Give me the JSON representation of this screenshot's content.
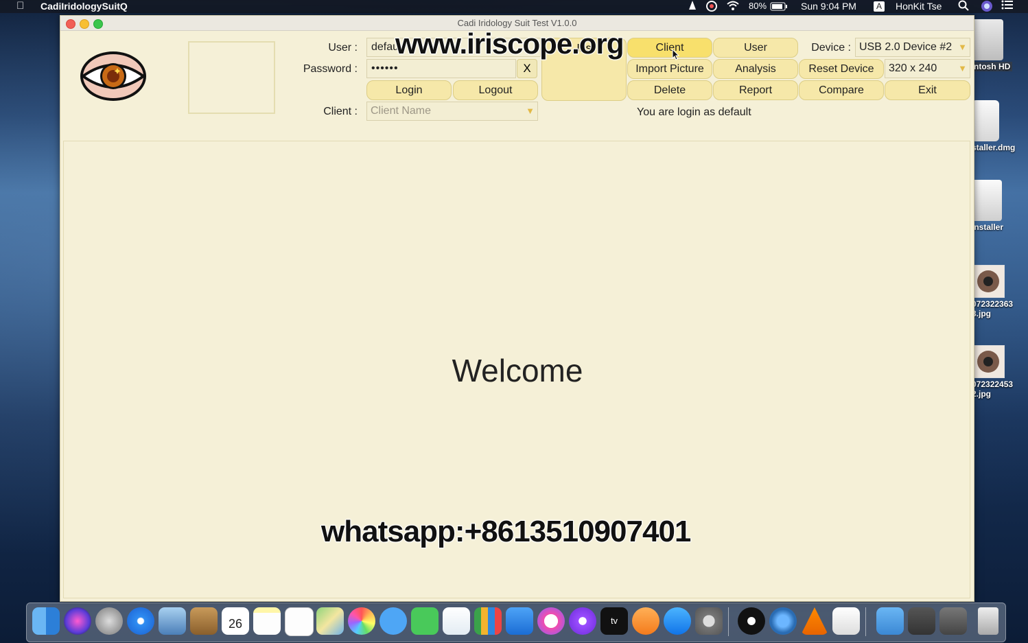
{
  "menubar": {
    "app_name": "CadiIridologySuitQ",
    "battery": "80%",
    "clock": "Sun 9:04 PM",
    "input_source": "A",
    "user": "HonKit Tse"
  },
  "window": {
    "title": "Cadi Iridology Suit Test V1.0.0"
  },
  "login": {
    "user_label": "User :",
    "user_value": "defau",
    "password_label": "Password :",
    "password_value": "••••••",
    "clear_label": "X",
    "login_label": "Login",
    "logout_label": "Logout",
    "client_label": "Client :",
    "client_placeholder": "Client Name"
  },
  "toolbar": {
    "iris": "Iris",
    "client": "Client",
    "user": "User",
    "import_picture": "Import Picture",
    "analysis": "Analysis",
    "delete": "Delete",
    "report": "Report",
    "reset_device": "Reset Device",
    "compare": "Compare",
    "exit": "Exit",
    "device_label": "Device :",
    "device_value": "USB 2.0 Device #2",
    "resolution_value": "320 x 240"
  },
  "status": "You are login as default",
  "main": {
    "welcome": "Welcome"
  },
  "watermarks": {
    "top": "www.iriscope.org",
    "bottom": "whatsapp:+8613510907401"
  },
  "desktop_icons": [
    {
      "label": "ntosh HD",
      "icon": "hard-drive-icon"
    },
    {
      "label": "staller.dmg",
      "icon": "disk-image-icon"
    },
    {
      "label": "Installer",
      "icon": "disk-icon"
    },
    {
      "label": "072322363\n3.jpg",
      "icon": "eye-image-icon"
    },
    {
      "label": "072322453\n2.jpg",
      "icon": "eye-image-icon"
    }
  ],
  "dock": {
    "calendar_day": "26"
  },
  "colors": {
    "window_bg": "#f5f0d7",
    "button_bg": "#f6e8a9",
    "button_active": "#f8e06c",
    "dropdown_arrow": "#e2b947"
  }
}
